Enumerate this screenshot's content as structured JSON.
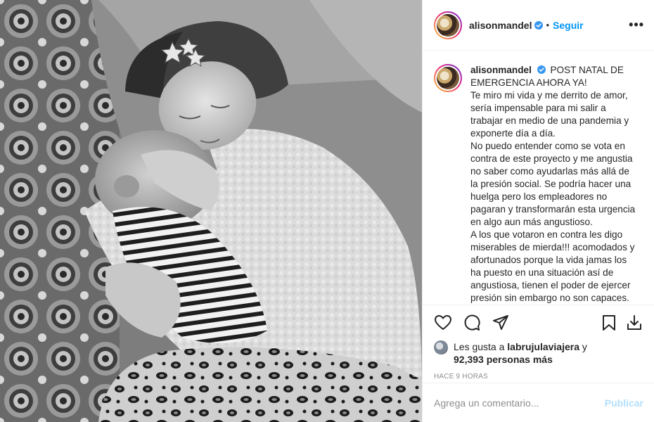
{
  "post": {
    "username": "alisonmandel",
    "follow_label": "Seguir",
    "more_label": "•••",
    "separator": "•",
    "photo_description_icon": "photo-mother-baby"
  },
  "caption": {
    "username": "alisonmandel",
    "lines": [
      "POST NATAL DE EMERGENCIA AHORA YA!",
      "Te miro mi vida y me derrito de amor, sería impensable para mi salir a trabajar en medio de una pandemia y exponerte día a día.",
      "No puedo entender como se vota en contra de este proyecto y me angustia no saber como ayudarlas más allá de la presión social. Se podría hacer una huelga pero los empleadores no pagaran y transformarán esta urgencia en algo aun más angustioso.",
      "A los que votaron en contra les digo miserables de mierda!!! acomodados y afortunados porque la vida jamas los ha puesto en una situación así de angustiosa, tienen el poder de ejercer presión sin embargo no son capaces."
    ]
  },
  "actions": {
    "like_icon": "heart-icon",
    "comment_icon": "comment-icon",
    "share_icon": "send-icon",
    "save_icon": "bookmark-icon",
    "download_icon": "download-icon"
  },
  "likes": {
    "prefix": "Les gusta a",
    "liker": "labrujulaviajera",
    "conjunction": "y",
    "count": "92,393 personas más"
  },
  "timestamp": "HACE 9 HORAS",
  "comment": {
    "placeholder": "Agrega un comentario...",
    "post_label": "Publicar"
  },
  "colors": {
    "link": "#0095f6",
    "post_disabled": "#b2dffc",
    "muted": "#8e8e8e",
    "text": "#262626"
  }
}
